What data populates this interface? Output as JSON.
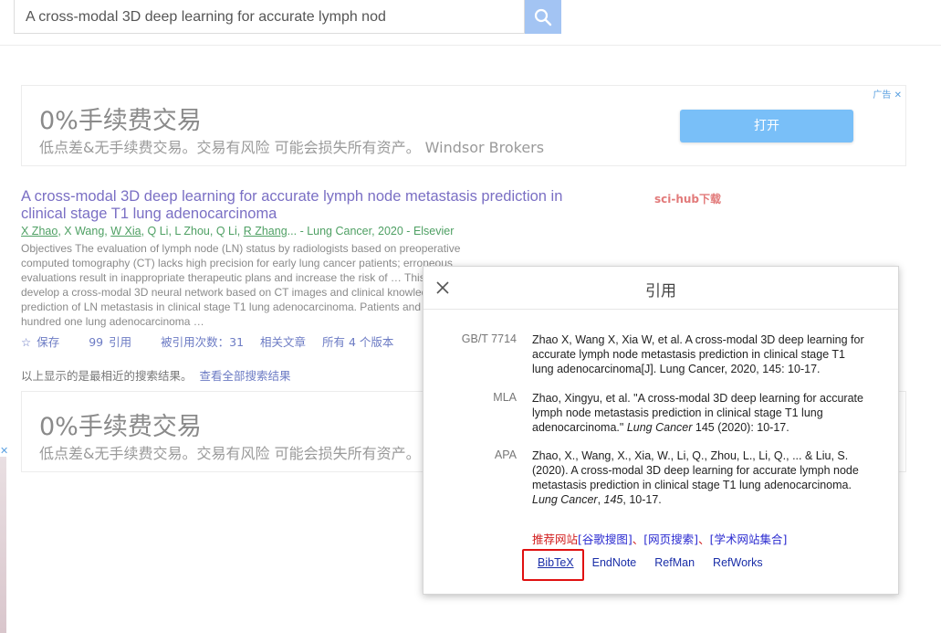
{
  "search": {
    "value": "A cross-modal 3D deep learning for accurate lymph nod",
    "button_icon": "search-icon"
  },
  "ad": {
    "title": "0%手续费交易",
    "subtitle": "低点差&无手续费交易。交易有风险 可能会损失所有资产。 Windsor Brokers",
    "subtitle_short": "低点差&无手续费交易。交易有风险 可能会损失所有资产。",
    "open_label": "打开",
    "tag": "广告",
    "close_glyph": "✕"
  },
  "result": {
    "title": "A cross-modal 3D deep learning for accurate lymph node metastasis prediction in clinical stage T1 lung adenocarcinoma",
    "scihub": "sci-hub下载",
    "authors": {
      "a1": "X Zhao",
      "a2": "X Wang",
      "a3": "W Xia",
      "a4": "Q Li",
      "a5": "L Zhou",
      "a6": "Q Li",
      "a7": "R Zhang",
      "tail": "... - Lung Cancer, 2020 - Elsevier"
    },
    "abstract": "Objectives The evaluation of lymph node (LN) status by radiologists based on preoperative computed tomography (CT) lacks high precision for early lung cancer patients; erroneous evaluations result in inappropriate therapeutic plans and increase the risk of … This study aims to develop a cross-modal 3D neural network based on CT images and clinical knowledge for accurate prediction of LN metastasis in clinical stage T1 lung adenocarcinoma. Patients and methods Five hundred one lung adenocarcinoma …",
    "actions": {
      "save": "保存",
      "cite": "引用",
      "cited_by": "被引用次数：31",
      "related": "相关文章",
      "versions": "所有 4 个版本"
    }
  },
  "closest": {
    "text": "以上显示的是最相近的搜索结果。",
    "link": "查看全部搜索结果"
  },
  "dialog": {
    "title": "引用",
    "citations": [
      {
        "label": "GB/T 7714",
        "pre": "Zhao X, Wang X, Xia W, et al. A cross-modal 3D deep learning for accurate lymph node metastasis prediction in clinical stage T1 lung adenocarcinoma[J]. Lung Cancer, 2020, 145: 10-17.",
        "journal": "",
        "post": ""
      },
      {
        "label": "MLA",
        "pre": "Zhao, Xingyu, et al. \"A cross-modal 3D deep learning for accurate lymph node metastasis prediction in clinical stage T1 lung adenocarcinoma.\" ",
        "journal": "Lung Cancer",
        "post": " 145 (2020): 10-17."
      },
      {
        "label": "APA",
        "pre": "Zhao, X., Wang, X., Xia, W., Li, Q., Zhou, L., Li, Q., ... & Liu, S. (2020). A cross-modal 3D deep learning for accurate lymph node metastasis prediction in clinical stage T1 lung adenocarcinoma. ",
        "journal": "Lung Cancer",
        "sep": ", ",
        "volume": "145",
        "post": ", 10-17."
      }
    ],
    "recommend": {
      "prefix": "推荐网站",
      "l1": "[谷歌搜图]",
      "sep1": "、",
      "l2": "[网页搜索]",
      "sep2": "、",
      "l3": "[学术网站集合]"
    },
    "exports": [
      "BibTeX",
      "EndNote",
      "RefMan",
      "RefWorks"
    ]
  }
}
